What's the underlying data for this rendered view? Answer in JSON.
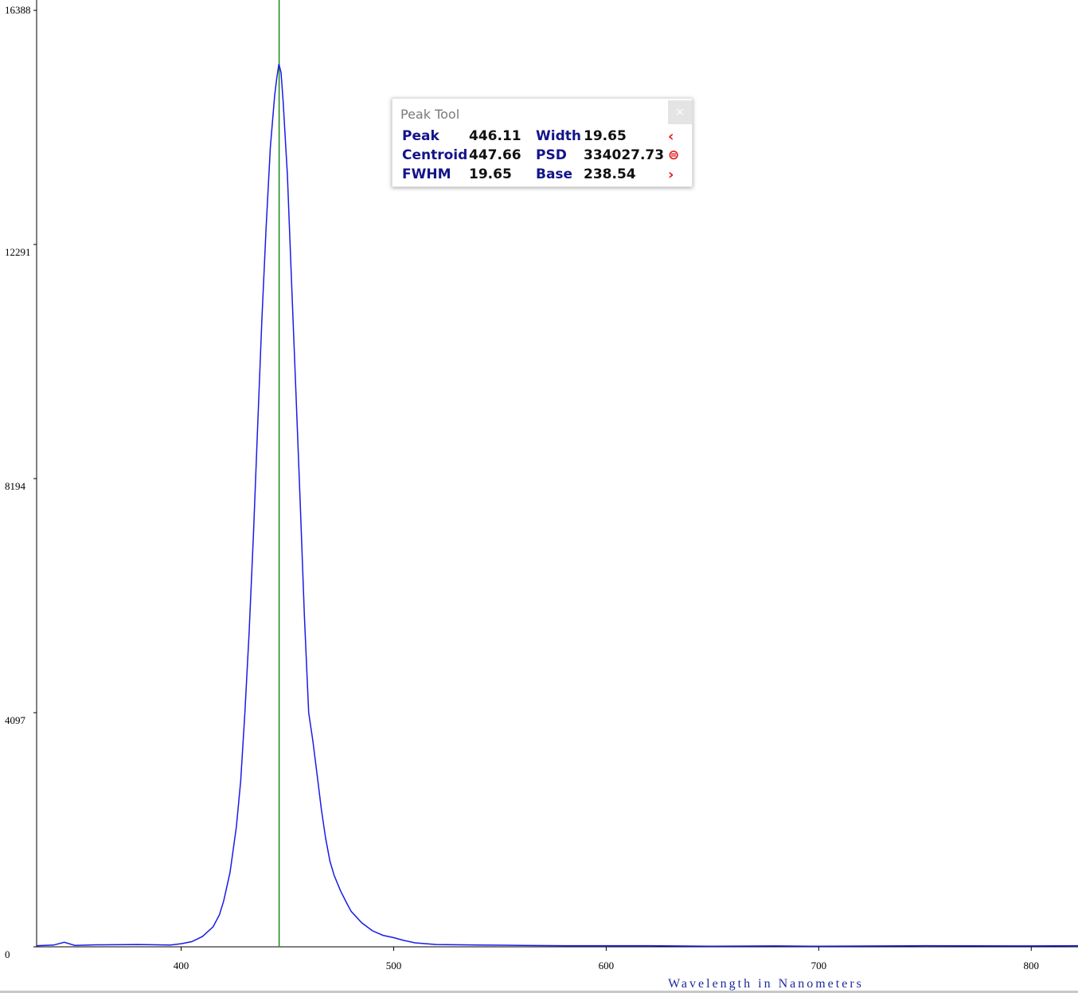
{
  "chart_data": {
    "type": "line",
    "xlabel": "Wavelength in Nanometers",
    "ylabel": "",
    "xlim": [
      332,
      822
    ],
    "ylim": [
      0,
      16388
    ],
    "x_ticks": [
      400,
      500,
      600,
      700,
      800
    ],
    "y_ticks": [
      0,
      4097,
      8194,
      12291,
      16388
    ],
    "y_tick_labels": [
      "0",
      "4097",
      "8194",
      "12291",
      "16388"
    ],
    "x_tick_labels": [
      "400",
      "500",
      "600",
      "700",
      "800"
    ],
    "marker_line_x": 446.11,
    "series": [
      {
        "color": "#1a1ae6",
        "x": [
          332,
          340,
          345,
          350,
          360,
          380,
          395,
          400,
          405,
          410,
          415,
          418,
          420,
          423,
          426,
          428,
          430,
          432,
          434,
          436,
          438,
          440,
          442,
          444,
          445,
          446,
          447,
          448,
          450,
          452,
          454,
          456,
          458,
          460,
          462,
          464,
          466,
          468,
          470,
          472,
          475,
          478,
          480,
          485,
          490,
          495,
          500,
          505,
          510,
          520,
          540,
          560,
          580,
          600,
          620,
          650,
          680,
          700,
          750,
          800,
          822
        ],
        "y": [
          20,
          30,
          80,
          25,
          35,
          40,
          30,
          55,
          90,
          180,
          350,
          560,
          800,
          1300,
          2100,
          2900,
          4100,
          5500,
          7200,
          9100,
          11000,
          12600,
          14000,
          14900,
          15200,
          15450,
          15300,
          14800,
          13500,
          11600,
          9700,
          7800,
          5800,
          4100,
          3600,
          3000,
          2400,
          1900,
          1500,
          1250,
          980,
          760,
          620,
          420,
          280,
          200,
          160,
          110,
          70,
          40,
          30,
          25,
          20,
          20,
          20,
          10,
          15,
          10,
          20,
          15,
          20
        ]
      }
    ]
  },
  "peak_tool": {
    "title": "Peak Tool",
    "close_glyph": "×",
    "rows": [
      {
        "label": "Peak",
        "value": "446.11",
        "label2": "Width",
        "value2": "19.65",
        "nav": "‹"
      },
      {
        "label": "Centroid",
        "value": "447.66",
        "label2": "PSD",
        "value2": "334027.73",
        "nav": "⊜"
      },
      {
        "label": "FWHM",
        "value": "19.65",
        "label2": "Base",
        "value2": "238.54",
        "nav": "›"
      }
    ],
    "accent_color": "#e02020",
    "label_color": "#14148a"
  }
}
